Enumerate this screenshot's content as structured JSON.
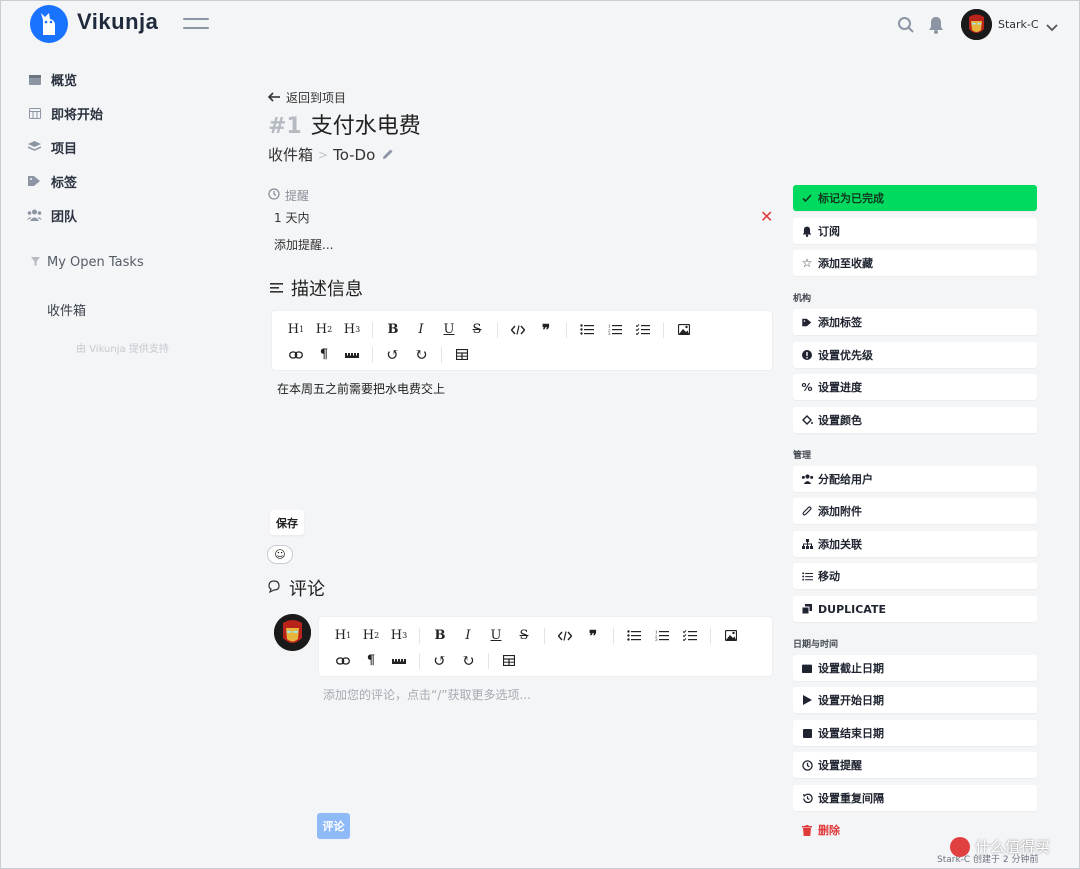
{
  "app": {
    "name": "Vikunja"
  },
  "header": {
    "user_name": "Stark-C"
  },
  "sidebar": {
    "items": [
      {
        "label": "概览",
        "icon": "calendar-icon"
      },
      {
        "label": "即将开始",
        "icon": "calendar-grid-icon"
      },
      {
        "label": "项目",
        "icon": "layers-icon"
      },
      {
        "label": "标签",
        "icon": "tags-icon"
      },
      {
        "label": "团队",
        "icon": "users-icon"
      }
    ],
    "saved_filter": "My Open Tasks",
    "project": "收件箱",
    "powered_by": "由 Vikunja 提供支持"
  },
  "task": {
    "back_label": "返回到项目",
    "id": "#1",
    "title": "支付水电费",
    "project": "收件箱",
    "bucket": "To-Do",
    "breadcrumb_sep": ">",
    "reminders_label": "提醒",
    "reminder": "1 天内",
    "add_reminder": "添加提醒...",
    "description_heading": "描述信息",
    "description": "在本周五之前需要把水电费交上",
    "save_label": "保存",
    "comments_heading": "评论",
    "comment_placeholder": "添加您的评论，点击“/”获取更多选项...",
    "comment_button": "评论",
    "created_info": "Stark-C 创建于 2 分钟前"
  },
  "toolbar": {
    "row1": [
      "H1",
      "H2",
      "H3",
      "B",
      "I",
      "U",
      "S",
      "code",
      "quote",
      "ul",
      "ol",
      "tasklist",
      "image"
    ],
    "row2": [
      "link",
      "paragraph",
      "ruler",
      "undo",
      "redo",
      "table"
    ]
  },
  "actions": {
    "done": "标记为已完成",
    "subscribe": "订阅",
    "favorite": "添加至收藏",
    "group_org": "机构",
    "add_labels": "添加标签",
    "set_priority": "设置优先级",
    "set_progress": "设置进度",
    "set_color": "设置颜色",
    "group_manage": "管理",
    "assign": "分配给用户",
    "attach": "添加附件",
    "relate": "添加关联",
    "move": "移动",
    "duplicate": "DUPLICATE",
    "group_dates": "日期与时间",
    "due_date": "设置截止日期",
    "start_date": "设置开始日期",
    "end_date": "设置结束日期",
    "reminders": "设置提醒",
    "repeat": "设置重复间隔",
    "delete": "删除"
  },
  "watermark": "什么值得买",
  "colors": {
    "primary": "#1973ff",
    "success": "#00db60",
    "danger": "#e03c3c"
  }
}
